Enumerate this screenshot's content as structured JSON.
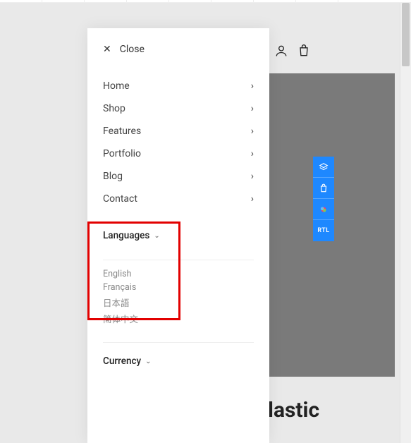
{
  "close": {
    "label": "Close"
  },
  "nav": {
    "items": [
      {
        "label": "Home"
      },
      {
        "label": "Shop"
      },
      {
        "label": "Features"
      },
      {
        "label": "Portfolio"
      },
      {
        "label": "Blog"
      },
      {
        "label": "Contact"
      }
    ]
  },
  "languages": {
    "title": "Languages",
    "options": [
      "English",
      "Français",
      "日本語",
      "简体中文"
    ]
  },
  "currency": {
    "title": "Currency"
  },
  "sideToolbar": {
    "rtl": "RTL"
  },
  "bg": {
    "text": "lastic"
  }
}
